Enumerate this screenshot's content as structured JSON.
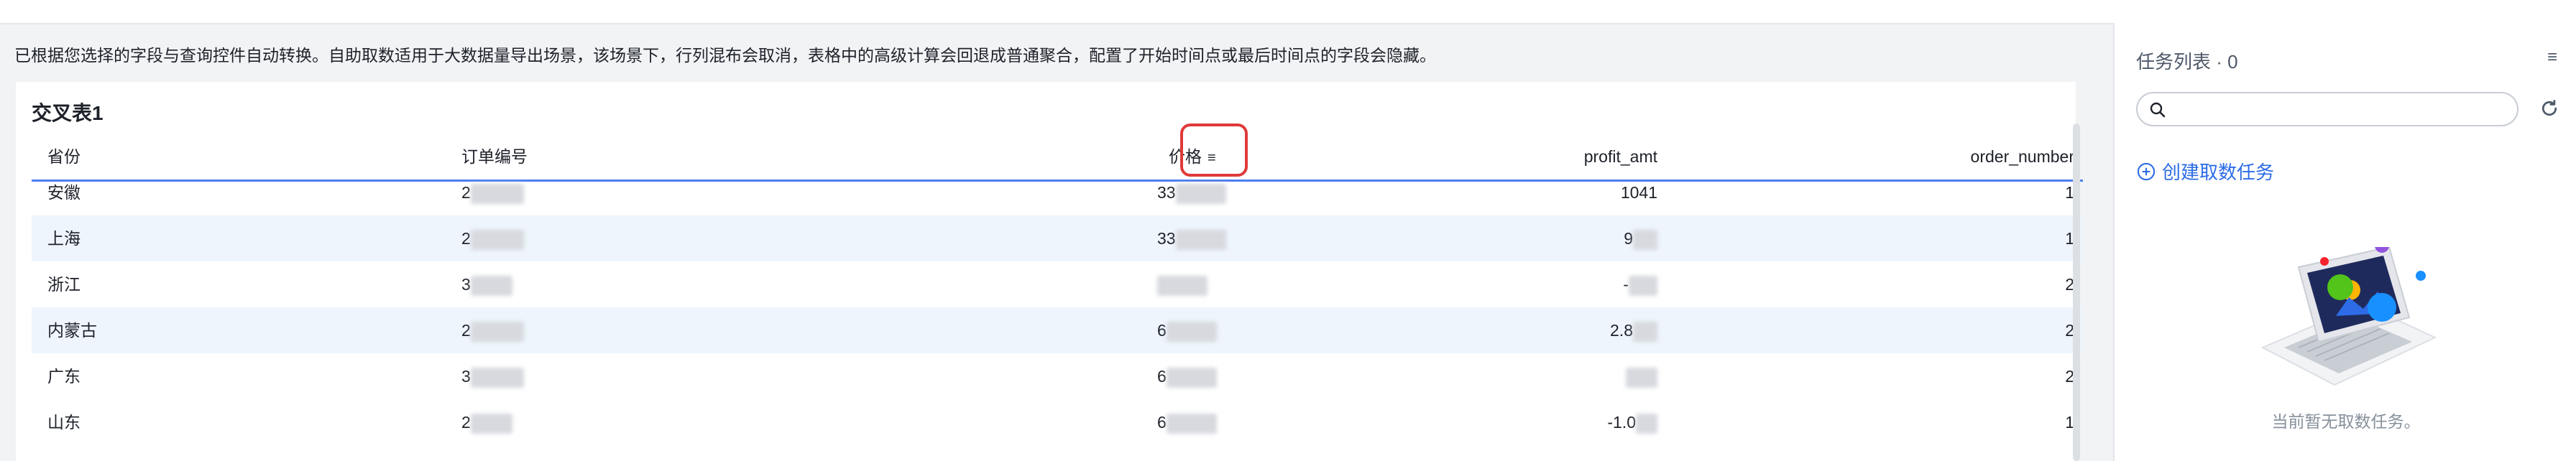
{
  "notice": "已根据您选择的字段与查询控件自动转换。自助取数适用于大数据量导出场景，该场景下，行列混布会取消，表格中的高级计算会回退成普通聚合，配置了开始时间点或最后时间点的字段会隐藏。",
  "table": {
    "title": "交叉表1",
    "headers": [
      "省份",
      "订单编号",
      "价格",
      "profit_amt",
      "order_number"
    ],
    "sort_icon": "sort-icon",
    "rows": [
      {
        "province": "安徽",
        "order_id_prefix": "2",
        "price_prefix": "33",
        "profit": "1041",
        "order_number": "1"
      },
      {
        "province": "上海",
        "order_id_prefix": "2",
        "price_prefix": "33",
        "profit": "9",
        "order_number": "1"
      },
      {
        "province": "浙江",
        "order_id_prefix": "3",
        "price_prefix": "",
        "profit": "-",
        "order_number": "2"
      },
      {
        "province": "内蒙古",
        "order_id_prefix": "2",
        "price_prefix": "6",
        "profit": "2.8",
        "order_number": "2"
      },
      {
        "province": "广东",
        "order_id_prefix": "3",
        "price_prefix": "6",
        "profit": "",
        "order_number": "2"
      },
      {
        "province": "山东",
        "order_id_prefix": "2",
        "price_prefix": "6",
        "profit": "-1.0",
        "order_number": "1"
      }
    ]
  },
  "task_panel": {
    "title": "任务列表 · 0",
    "search_placeholder": "",
    "create_label": "创建取数任务",
    "empty_text": "当前暂无取数任务。"
  },
  "colors": {
    "accent": "#2d6ce6",
    "header_border": "#4d7ef0",
    "row_alt": "#eef5fc",
    "highlight": "#e03a3a"
  }
}
